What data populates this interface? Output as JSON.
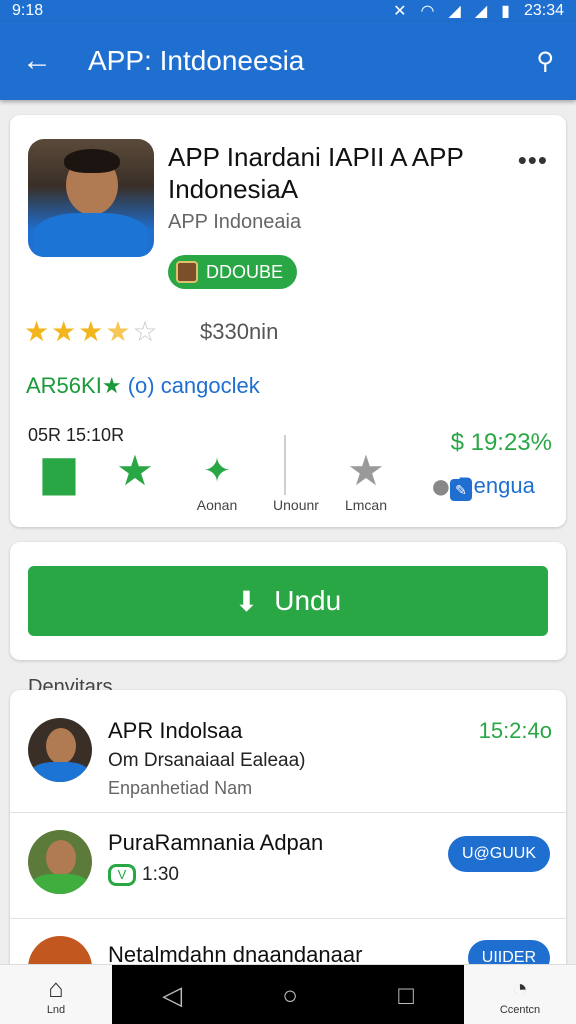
{
  "status": {
    "time": "9:18",
    "battery": "23:34"
  },
  "appbar": {
    "title": "APP: Intdoneesia"
  },
  "app": {
    "name": "APP Inardani IAPII A APP IndonesiaA",
    "developer": "APP Indoneaia",
    "badge": "DDOUBE",
    "rating": 3.5,
    "price": "$330nin",
    "tagline_prefix": "AR56KI",
    "tagline_suffix": "(o) cangoclek",
    "size_label": "05R 15:10R",
    "percent": "$ 19:23%",
    "actions": [
      {
        "label": ""
      },
      {
        "label": ""
      },
      {
        "label": "Aonan"
      },
      {
        "label": "Unounr"
      },
      {
        "label": "Lmcan"
      }
    ],
    "rengua": "Rengua"
  },
  "download": {
    "label": "Undu"
  },
  "section": {
    "title": "Denvitars"
  },
  "list": [
    {
      "title": "APR Indolsaa",
      "line2": "Om Drsanaiaal Ealeaa)",
      "line3": "Enpanhetiad Nam",
      "right": "15:2:4o"
    },
    {
      "title": "PuraRamnania Adpan",
      "time": "1:30",
      "badge": "V",
      "button": "U@GUUK"
    },
    {
      "title": "Netalmdahn dnaandanaar",
      "button": "UIIDER"
    }
  ],
  "nav": {
    "home": "Lnd",
    "right": "Ccentcn"
  }
}
